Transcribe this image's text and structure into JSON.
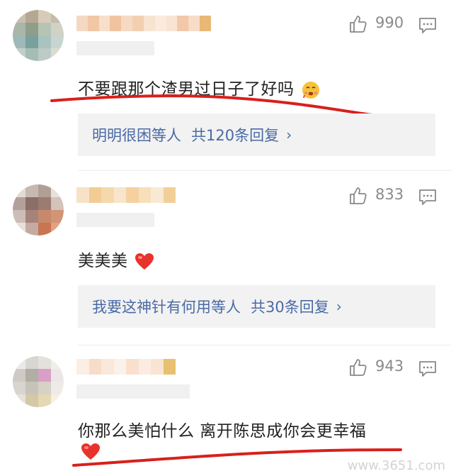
{
  "comments": [
    {
      "likes": "990",
      "text": "不要跟那个渣男过日子了好吗",
      "emoji": "drooling-face-icon",
      "replies_users": "明明很困等人",
      "replies_count": "共120条回复"
    },
    {
      "likes": "833",
      "text": "美美美",
      "emoji": "heart-icon",
      "replies_users": "我要这神针有何用等人",
      "replies_count": "共30条回复"
    },
    {
      "likes": "943",
      "text": "你那么美怕什么 离开陈思成你会更幸福",
      "emoji": "heart-icon"
    }
  ],
  "watermark": "www.3651.com",
  "colors": {
    "link": "#4a6aa5",
    "underline": "#d8201c",
    "heart": "#e8332c"
  }
}
